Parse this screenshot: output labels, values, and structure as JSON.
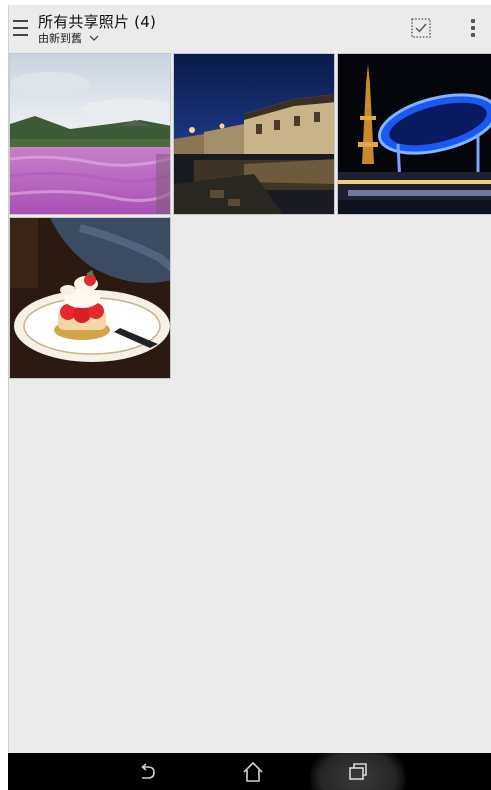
{
  "header": {
    "title": "所有共享照片 (4)",
    "sort_label": "由新到舊",
    "menu_icon": "hamburger-menu-icon",
    "select_icon": "multi-select-checkbox-icon",
    "more_icon": "overflow-more-icon"
  },
  "photos": [
    {
      "subject": "pink-flower-field-photo"
    },
    {
      "subject": "night-canal-warehouses-photo"
    },
    {
      "subject": "illuminated-tower-and-blue-roof-photo"
    },
    {
      "subject": "strawberry-shortcake-dessert-photo"
    }
  ],
  "navbar": {
    "back_icon": "back-icon",
    "home_icon": "home-icon",
    "recent_icon": "recent-apps-icon"
  },
  "colors": {
    "background": "#ebebeb",
    "navbar": "#000000",
    "icon": "#444444"
  }
}
